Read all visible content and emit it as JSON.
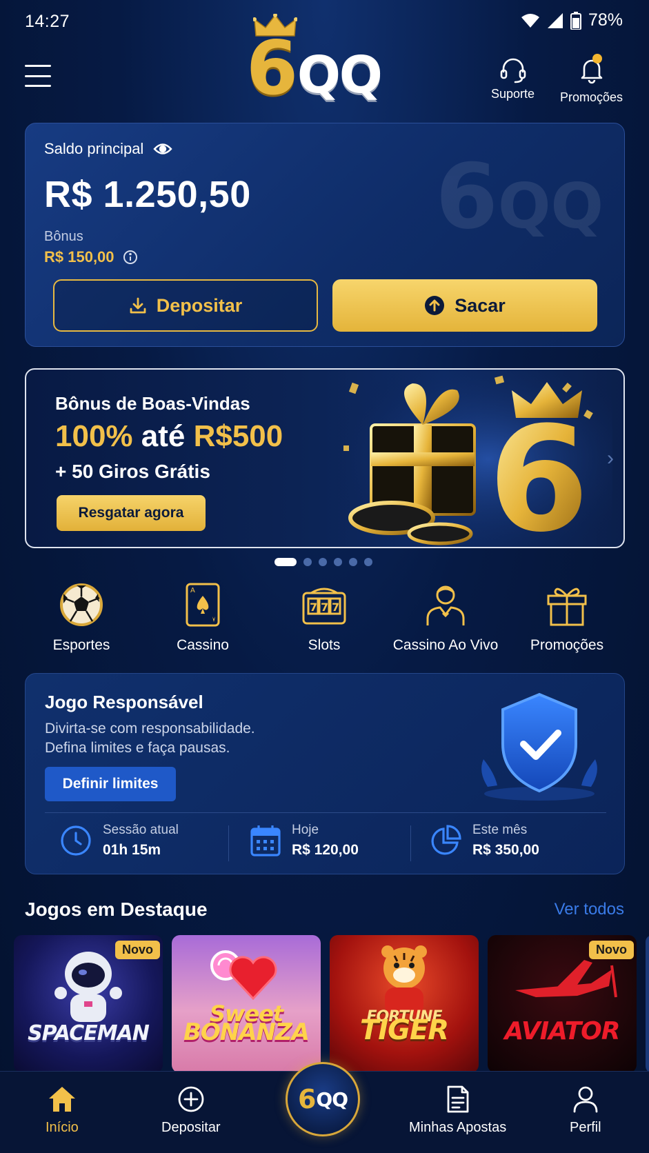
{
  "status_bar": {
    "time": "14:27",
    "battery": "78%"
  },
  "header": {
    "logo_six": "6",
    "logo_qq": "QQ",
    "support_label": "Suporte",
    "promotions_label": "Promoções"
  },
  "balance": {
    "label": "Saldo principal",
    "amount": "R$ 1.250,50",
    "bonus_label": "Bônus",
    "bonus_value": "R$ 150,00",
    "deposit_label": "Depositar",
    "withdraw_label": "Sacar"
  },
  "banner": {
    "title": "Bônus de Boas-Vindas",
    "offer_percent": "100%",
    "offer_mid": " até ",
    "offer_amount": "R$500",
    "spins": "+ 50 Giros Grátis",
    "cta": "Resgatar agora",
    "slide_count": 6,
    "active_slide": 0
  },
  "categories": [
    {
      "label": "Esportes",
      "icon": "soccer-ball-icon"
    },
    {
      "label": "Cassino",
      "icon": "playing-card-icon"
    },
    {
      "label": "Slots",
      "icon": "slot-machine-icon"
    },
    {
      "label": "Cassino Ao Vivo",
      "icon": "dealer-icon"
    },
    {
      "label": "Promoções",
      "icon": "gift-icon"
    }
  ],
  "responsible": {
    "title": "Jogo Responsável",
    "desc_line1": "Divirta-se com responsabilidade.",
    "desc_line2": "Defina limites e faça pausas.",
    "button": "Definir limites",
    "stats": [
      {
        "label": "Sessão atual",
        "value": "01h 15m",
        "icon": "clock-icon"
      },
      {
        "label": "Hoje",
        "value": "R$ 120,00",
        "icon": "calendar-icon"
      },
      {
        "label": "Este mês",
        "value": "R$ 350,00",
        "icon": "pie-chart-icon"
      }
    ]
  },
  "featured": {
    "title": "Jogos em Destaque",
    "see_all": "Ver todos",
    "games": [
      {
        "name": "SPACEMAN",
        "badge": "Novo"
      },
      {
        "name_line1": "Sweet",
        "name_line2": "BONANZA",
        "badge": ""
      },
      {
        "name_line1": "FORTUNE",
        "name_line2": "TIGER",
        "badge": ""
      },
      {
        "name": "AVIATOR",
        "badge": "Novo"
      }
    ]
  },
  "bottom_nav": {
    "items": [
      {
        "label": "Início",
        "icon": "home-icon",
        "active": true
      },
      {
        "label": "Depositar",
        "icon": "plus-circle-icon"
      },
      {
        "label": "Minhas Apostas",
        "icon": "document-icon"
      },
      {
        "label": "Perfil",
        "icon": "user-icon"
      }
    ],
    "center_six": "6",
    "center_qq": "QQ"
  },
  "colors": {
    "gold": "#f2c04a",
    "accent_blue": "#3a7be8",
    "background": "#061a44"
  }
}
